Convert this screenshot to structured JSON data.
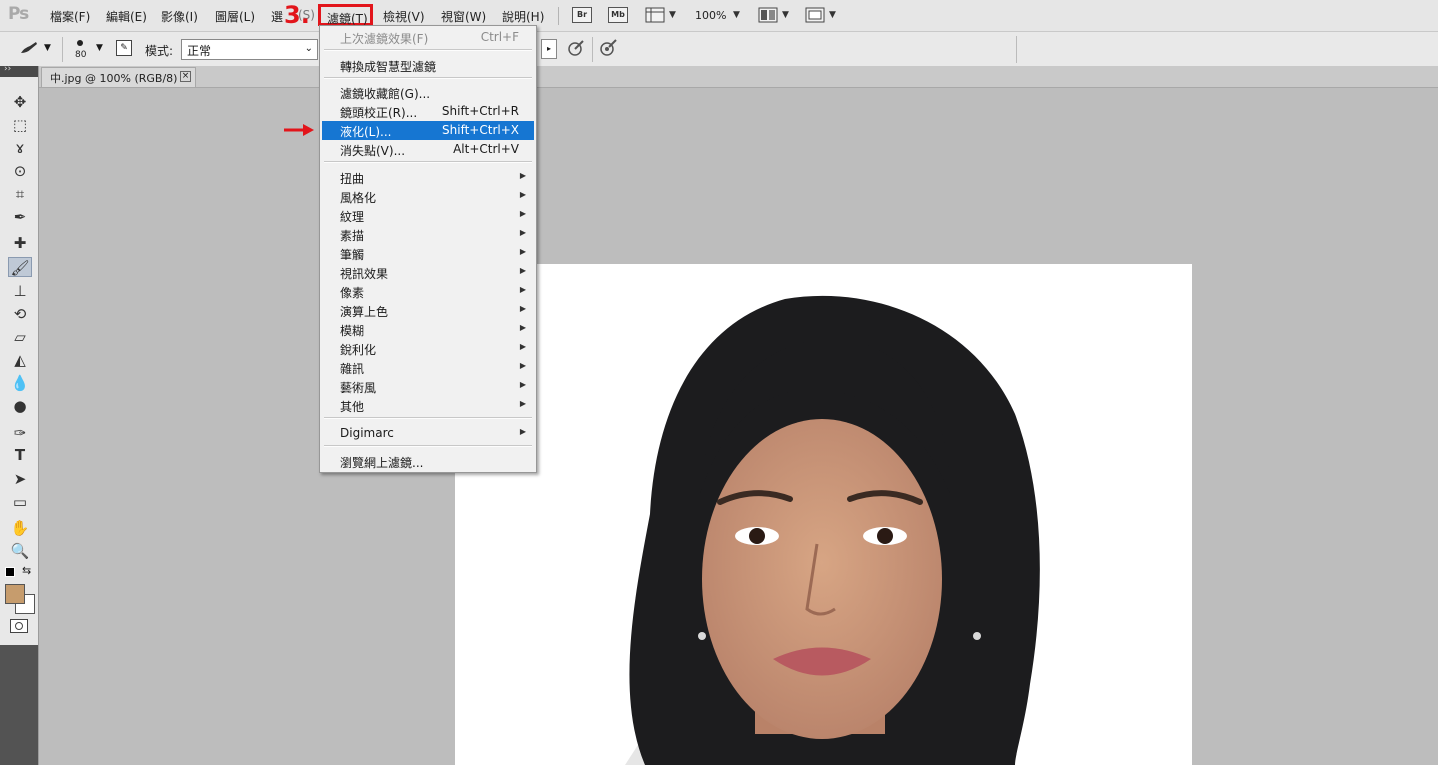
{
  "app": {
    "logo": "Ps"
  },
  "menubar": {
    "items": [
      "檔案(F)",
      "編輯(E)",
      "影像(I)",
      "圖層(L)",
      "選",
      "(S)",
      "濾鏡(T)",
      "檢視(V)",
      "視窗(W)",
      "說明(H)"
    ],
    "step_label": "3.",
    "bridge_label": "Br",
    "minibridge_label": "Mb",
    "zoom": "100%"
  },
  "options": {
    "brush_size": "80",
    "mode_label": "模式:",
    "mode_value": "正常"
  },
  "document": {
    "tab_title": "中.jpg @ 100% (RGB/8)",
    "close_glyph": "×"
  },
  "filter_menu": {
    "items": [
      {
        "label": "上次濾鏡效果(F)",
        "shortcut": "Ctrl+F",
        "disabled": true
      },
      {
        "label": "轉換成智慧型濾鏡"
      },
      {
        "label": "濾鏡收藏館(G)..."
      },
      {
        "label": "鏡頭校正(R)...",
        "shortcut": "Shift+Ctrl+R"
      },
      {
        "label": "液化(L)...",
        "shortcut": "Shift+Ctrl+X",
        "highlighted": true
      },
      {
        "label": "消失點(V)...",
        "shortcut": "Alt+Ctrl+V"
      },
      {
        "label": "扭曲",
        "submenu": true
      },
      {
        "label": "風格化",
        "submenu": true
      },
      {
        "label": "紋理",
        "submenu": true
      },
      {
        "label": "素描",
        "submenu": true
      },
      {
        "label": "筆觸",
        "submenu": true
      },
      {
        "label": "視訊效果",
        "submenu": true
      },
      {
        "label": "像素",
        "submenu": true
      },
      {
        "label": "演算上色",
        "submenu": true
      },
      {
        "label": "模糊",
        "submenu": true
      },
      {
        "label": "銳利化",
        "submenu": true
      },
      {
        "label": "雜訊",
        "submenu": true
      },
      {
        "label": "藝術風",
        "submenu": true
      },
      {
        "label": "其他",
        "submenu": true
      },
      {
        "label": "Digimarc",
        "submenu": true
      },
      {
        "label": "瀏覽網上濾鏡..."
      }
    ]
  },
  "colors": {
    "highlight": "#1676d2",
    "annotation_red": "#e2151b",
    "foreground_swatch": "#c69c6d",
    "background_swatch": "#ffffff"
  }
}
